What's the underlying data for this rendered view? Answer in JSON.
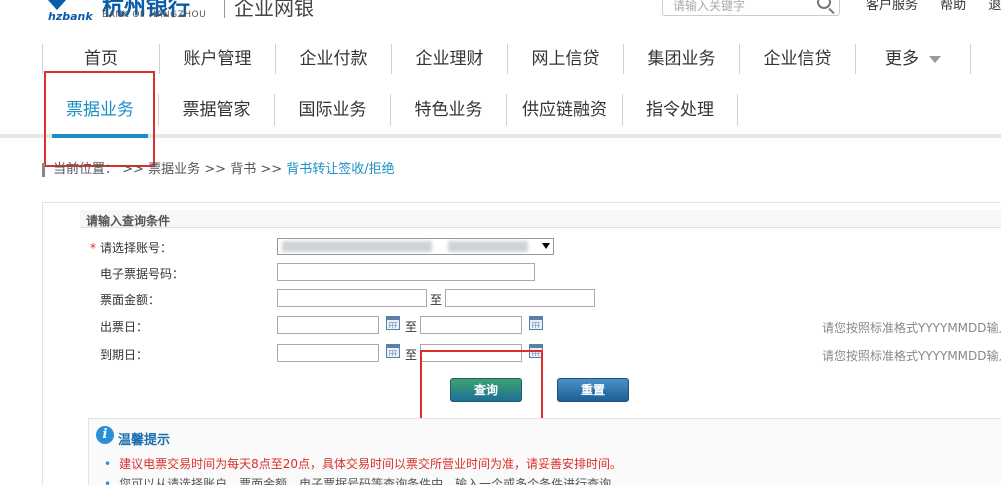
{
  "header": {
    "logo_en": "hzbank",
    "logo_cn": "杭州银行",
    "logo_sub": "BANK OF HANGZHOU",
    "product_title": "企业网银",
    "search_placeholder": "请输入关键字",
    "top_links": [
      "客户服务",
      "帮助",
      "退出"
    ]
  },
  "nav_main": [
    {
      "label": "首页",
      "width": 117
    },
    {
      "label": "账户管理",
      "width": 116
    },
    {
      "label": "企业付款",
      "width": 116
    },
    {
      "label": "企业理财",
      "width": 116
    },
    {
      "label": "网上信贷",
      "width": 116
    },
    {
      "label": "集团业务",
      "width": 116
    },
    {
      "label": "企业信贷",
      "width": 116
    },
    {
      "label": "更多",
      "width": 116
    }
  ],
  "nav_sub": [
    {
      "label": "票据业务",
      "active": true
    },
    {
      "label": "票据管家",
      "active": false
    },
    {
      "label": "国际业务",
      "active": false
    },
    {
      "label": "特色业务",
      "active": false
    },
    {
      "label": "供应链融资",
      "active": false
    },
    {
      "label": "指令处理",
      "active": false
    }
  ],
  "breadcrumb": {
    "prefix": "当前位置：",
    "sep": ">>",
    "items": [
      "票据业务",
      "背书"
    ],
    "current": "背书转让签收/拒绝"
  },
  "query_panel": {
    "title": "请输入查询条件",
    "required_mark": "*",
    "account_label": "请选择账号：",
    "bill_no_label": "电子票据号码：",
    "amount_label": "票面金额：",
    "issue_date_label": "出票日：",
    "due_date_label": "到期日：",
    "to_label": "至",
    "date_hint": "请您按照标准格式YYYYMMDD输入",
    "query_button": "查询",
    "reset_button": "重置"
  },
  "tips": {
    "title": "温馨提示",
    "lines": [
      "建议电票交易时间为每天8点至20点，具体交易时间以票交所营业时间为准，请妥善安排时间。",
      "您可以从请选择账户、票面金额、电子票据号码等查询条件中，输入一个或多个条件进行查询。"
    ]
  },
  "colors": {
    "brand_blue": "#0a5ca8",
    "active_tab": "#1a8fc4",
    "annotation_red": "#d9302c"
  }
}
